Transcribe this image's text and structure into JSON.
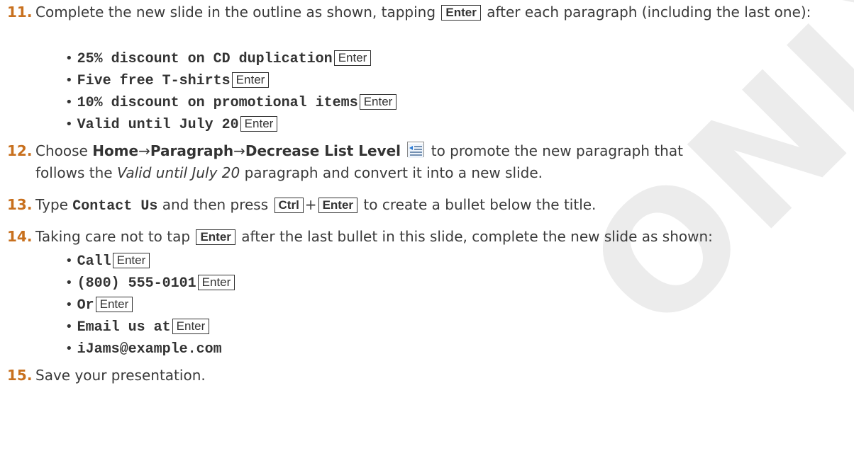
{
  "watermark": "ONLY",
  "step11": {
    "num": "11.",
    "t1": "Complete the new slide in the outline as shown, tapping",
    "key": "Enter",
    "t2": "after each paragraph (including the last one):",
    "bullets": [
      {
        "text": "25% discount on CD duplication",
        "key": "Enter"
      },
      {
        "text": "Five free T-shirts",
        "key": "Enter"
      },
      {
        "text": "10% discount on promotional items",
        "key": "Enter"
      },
      {
        "text": "Valid until July 20",
        "key": "Enter"
      }
    ]
  },
  "step12": {
    "num": "12.",
    "t1": "Choose",
    "home": "Home",
    "arrow": "→",
    "paragraph": "Paragraph",
    "decrease": "Decrease List Level",
    "icon": "decrease-list-level-icon",
    "t2": "to promote the new paragraph that",
    "t3": "follows the",
    "italic": "Valid until July 20",
    "t4": "paragraph and convert it into a new slide."
  },
  "step13": {
    "num": "13.",
    "t1": "Type",
    "code": "Contact Us",
    "t2": "and then press",
    "key1": "Ctrl",
    "plus": "+",
    "key2": "Enter",
    "t3": "to create a bullet below the title."
  },
  "step14": {
    "num": "14.",
    "t1": "Taking care not to tap",
    "key": "Enter",
    "t2": "after the last bullet in this slide, complete the new slide as shown:",
    "bullets": [
      {
        "text": "Call",
        "key": "Enter"
      },
      {
        "text": "(800) 555-0101",
        "key": "Enter"
      },
      {
        "text": "Or",
        "key": "Enter"
      },
      {
        "text": "Email us at",
        "key": "Enter"
      },
      {
        "text": "iJams@example.com",
        "key": ""
      }
    ]
  },
  "step15": {
    "num": "15.",
    "t1": "Save your presentation."
  }
}
